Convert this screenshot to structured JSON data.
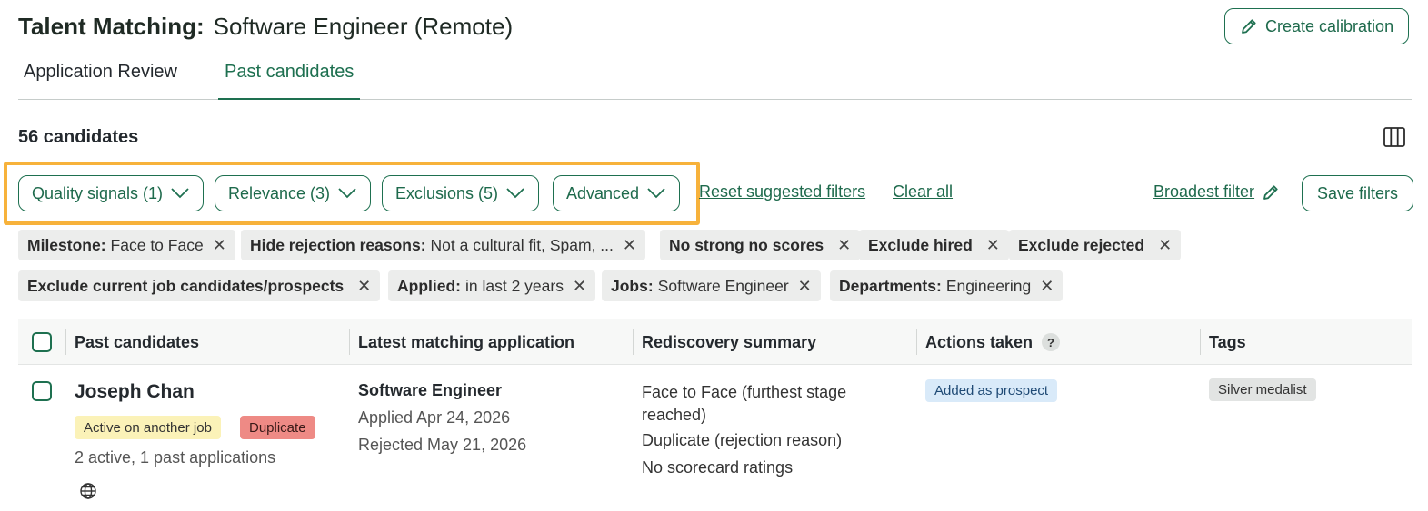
{
  "header": {
    "title_prefix": "Talent Matching:",
    "title_job": "Software Engineer (Remote)",
    "create_calibration_label": "Create calibration"
  },
  "tabs": [
    {
      "label": "Application Review",
      "active": false
    },
    {
      "label": "Past candidates",
      "active": true
    }
  ],
  "candidate_count": "56 candidates",
  "filters": {
    "buttons": [
      {
        "label": "Quality signals (1)"
      },
      {
        "label": "Relevance (3)"
      },
      {
        "label": "Exclusions (5)"
      },
      {
        "label": "Advanced"
      }
    ],
    "reset_label": "Reset suggested filters",
    "clear_label": "Clear all",
    "broadest_label": "Broadest filter",
    "save_label": "Save filters",
    "highlight_color": "#f7b23b"
  },
  "chips": [
    {
      "key": "Milestone:",
      "value": "Face to Face"
    },
    {
      "key": "Hide rejection reasons:",
      "value": "Not a cultural fit, Spam, ..."
    },
    {
      "key": "No strong no scores",
      "value": ""
    },
    {
      "key": "Exclude hired",
      "value": ""
    },
    {
      "key": "Exclude rejected",
      "value": ""
    },
    {
      "key": "Exclude current job candidates/prospects",
      "value": ""
    },
    {
      "key": "Applied:",
      "value": "in last 2 years"
    },
    {
      "key": "Jobs:",
      "value": "Software Engineer"
    },
    {
      "key": "Departments:",
      "value": "Engineering"
    }
  ],
  "table": {
    "columns": [
      "Past candidates",
      "Latest matching application",
      "Rediscovery summary",
      "Actions taken",
      "Tags"
    ],
    "actions_help": "?",
    "rows": [
      {
        "name": "Joseph Chan",
        "badges": [
          "Active on another job",
          "Duplicate"
        ],
        "applications": "2 active, 1 past applications",
        "job": "Software Engineer",
        "applied": "Applied Apr 24, 2026",
        "rejected": "Rejected May 21, 2026",
        "summary": [
          "Face to Face (furthest stage reached)",
          "Duplicate (rejection reason)",
          "No scorecard ratings"
        ],
        "action": "Added as prospect",
        "tag": "Silver medalist"
      }
    ]
  },
  "colors": {
    "accent": "#1e7050",
    "badge_active": "#fbf2b8",
    "badge_duplicate": "#ee8a85",
    "prospect_tag": "#d9eaf9"
  },
  "icons": [
    "pencil-icon",
    "chevron-down-icon",
    "close-icon",
    "columns-icon",
    "globe-icon",
    "help-icon"
  ]
}
